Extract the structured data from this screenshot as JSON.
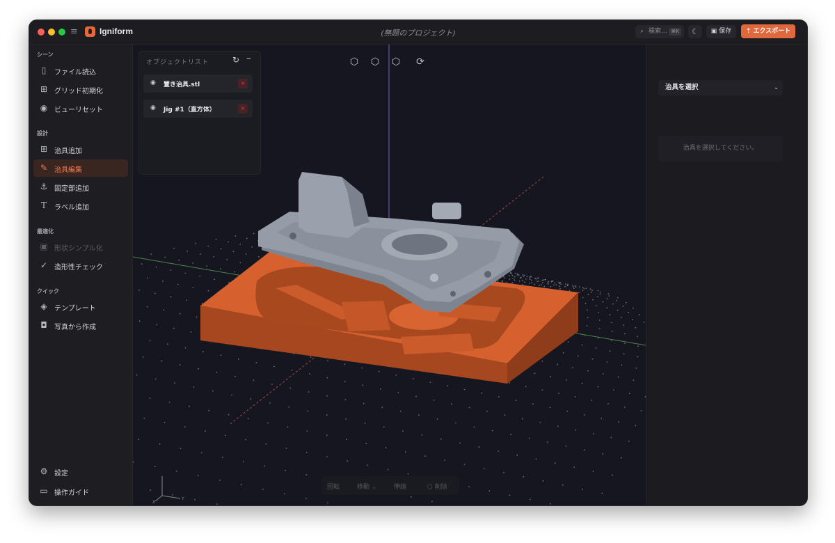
{
  "titlebar": {
    "app_name": "Igniform",
    "project_title": "(無題のプロジェクト)",
    "search_placeholder": "検索...",
    "search_shortcut": "⌘K",
    "save_label": "保存",
    "export_label": "エクスポート"
  },
  "sidebar": {
    "sections": [
      {
        "label": "シーン",
        "items": [
          {
            "label": "ファイル読込",
            "icon": "file-icon"
          },
          {
            "label": "グリッド初期化",
            "icon": "grid-icon"
          },
          {
            "label": "ビューリセット",
            "icon": "eye-icon"
          }
        ]
      },
      {
        "label": "設計",
        "items": [
          {
            "label": "治具追加",
            "icon": "plus-square-icon"
          },
          {
            "label": "治具編集",
            "icon": "edit-icon",
            "active": true
          },
          {
            "label": "固定部追加",
            "icon": "anchor-icon"
          },
          {
            "label": "ラベル追加",
            "icon": "text-icon"
          }
        ]
      },
      {
        "label": "最適化",
        "items": [
          {
            "label": "形状シンプル化",
            "icon": "simplify-icon",
            "disabled": true
          },
          {
            "label": "造形性チェック",
            "icon": "check-circle-icon"
          }
        ]
      },
      {
        "label": "クイック",
        "items": [
          {
            "label": "テンプレート",
            "icon": "layers-icon"
          },
          {
            "label": "写真から作成",
            "icon": "camera-icon"
          }
        ]
      }
    ],
    "footer": [
      {
        "label": "設定",
        "icon": "gear-icon"
      },
      {
        "label": "操作ガイド",
        "icon": "book-icon"
      }
    ]
  },
  "object_list": {
    "title": "オブジェクトリスト",
    "items": [
      {
        "name": "置き治具.stl"
      },
      {
        "name": "Jig #1（直方体）"
      }
    ]
  },
  "right_panel": {
    "select_label": "治具を選択",
    "hint": "治具を選択してください。"
  },
  "bottom_toolbar": {
    "rotate": "回転",
    "move": "移動",
    "scale": "伸縮",
    "delete": "削除"
  },
  "axis_labels": {
    "x": "X",
    "y": "Y"
  },
  "colors": {
    "accent": "#e0683d",
    "jig_orange": "#d5612f",
    "part_gray": "#8f97a2",
    "viewport_bg": "#161620"
  }
}
